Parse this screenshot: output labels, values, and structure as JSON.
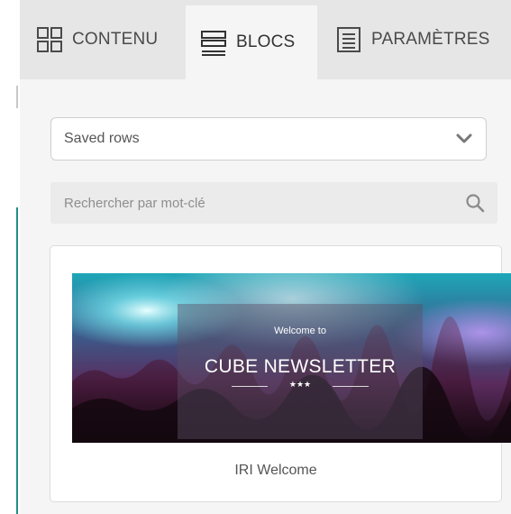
{
  "tabs": [
    {
      "label": "CONTENU",
      "icon": "grid-icon",
      "active": false
    },
    {
      "label": "BLOCS",
      "icon": "rows-icon",
      "active": true
    },
    {
      "label": "PARAMÈTRES",
      "icon": "document-lines-icon",
      "active": false
    }
  ],
  "rows_select": {
    "value": "Saved rows",
    "icon": "chevron-down-icon"
  },
  "search": {
    "placeholder": "Rechercher par mot-clé",
    "icon": "search-icon"
  },
  "saved_row": {
    "name": "IRI Welcome",
    "banner": {
      "line1": "Welcome to",
      "line2": "CUBE NEWSLETTER",
      "ornament": "★★★"
    }
  },
  "colors": {
    "accent_edge": "#1f8f8a",
    "tab_bar": "#e6e6e6",
    "panel": "#f5f5f5"
  }
}
